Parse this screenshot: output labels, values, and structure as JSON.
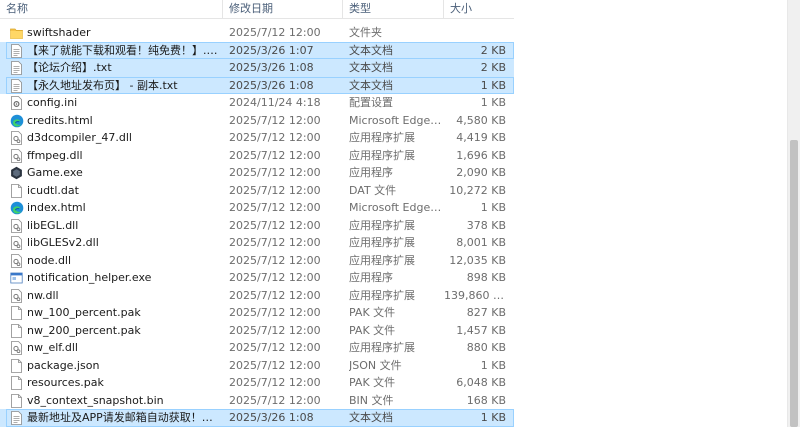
{
  "columns": {
    "name": "名称",
    "date": "修改日期",
    "type": "类型",
    "size": "大小"
  },
  "files": [
    {
      "name": "swiftshader",
      "date": "2025/7/12 12:00",
      "type": "文件夹",
      "size": "",
      "icon": "folder-icon",
      "selected": false
    },
    {
      "name": "【来了就能下载和观看！纯免费！】.txt",
      "date": "2025/3/26 1:07",
      "type": "文本文档",
      "size": "2 KB",
      "icon": "text-file-icon",
      "selected": true
    },
    {
      "name": "【论坛介绍】.txt",
      "date": "2025/3/26 1:08",
      "type": "文本文档",
      "size": "2 KB",
      "icon": "text-file-icon",
      "selected": true
    },
    {
      "name": "【永久地址发布页】 - 副本.txt",
      "date": "2025/3/26 1:08",
      "type": "文本文档",
      "size": "1 KB",
      "icon": "text-file-icon",
      "selected": true
    },
    {
      "name": "config.ini",
      "date": "2024/11/24 4:18",
      "type": "配置设置",
      "size": "1 KB",
      "icon": "settings-file-icon",
      "selected": false
    },
    {
      "name": "credits.html",
      "date": "2025/7/12 12:00",
      "type": "Microsoft Edge ...",
      "size": "4,580 KB",
      "icon": "edge-icon",
      "selected": false
    },
    {
      "name": "d3dcompiler_47.dll",
      "date": "2025/7/12 12:00",
      "type": "应用程序扩展",
      "size": "4,419 KB",
      "icon": "dll-icon",
      "selected": false
    },
    {
      "name": "ffmpeg.dll",
      "date": "2025/7/12 12:00",
      "type": "应用程序扩展",
      "size": "1,696 KB",
      "icon": "dll-icon",
      "selected": false
    },
    {
      "name": "Game.exe",
      "date": "2025/7/12 12:00",
      "type": "应用程序",
      "size": "2,090 KB",
      "icon": "game-exe-icon",
      "selected": false
    },
    {
      "name": "icudtl.dat",
      "date": "2025/7/12 12:00",
      "type": "DAT 文件",
      "size": "10,272 KB",
      "icon": "blank-file-icon",
      "selected": false
    },
    {
      "name": "index.html",
      "date": "2025/7/12 12:00",
      "type": "Microsoft Edge ...",
      "size": "1 KB",
      "icon": "edge-icon",
      "selected": false
    },
    {
      "name": "libEGL.dll",
      "date": "2025/7/12 12:00",
      "type": "应用程序扩展",
      "size": "378 KB",
      "icon": "dll-icon",
      "selected": false
    },
    {
      "name": "libGLESv2.dll",
      "date": "2025/7/12 12:00",
      "type": "应用程序扩展",
      "size": "8,001 KB",
      "icon": "dll-icon",
      "selected": false
    },
    {
      "name": "node.dll",
      "date": "2025/7/12 12:00",
      "type": "应用程序扩展",
      "size": "12,035 KB",
      "icon": "dll-icon",
      "selected": false
    },
    {
      "name": "notification_helper.exe",
      "date": "2025/7/12 12:00",
      "type": "应用程序",
      "size": "898 KB",
      "icon": "exe-icon",
      "selected": false
    },
    {
      "name": "nw.dll",
      "date": "2025/7/12 12:00",
      "type": "应用程序扩展",
      "size": "139,860 KB",
      "icon": "dll-icon",
      "selected": false
    },
    {
      "name": "nw_100_percent.pak",
      "date": "2025/7/12 12:00",
      "type": "PAK 文件",
      "size": "827 KB",
      "icon": "blank-file-icon",
      "selected": false
    },
    {
      "name": "nw_200_percent.pak",
      "date": "2025/7/12 12:00",
      "type": "PAK 文件",
      "size": "1,457 KB",
      "icon": "blank-file-icon",
      "selected": false
    },
    {
      "name": "nw_elf.dll",
      "date": "2025/7/12 12:00",
      "type": "应用程序扩展",
      "size": "880 KB",
      "icon": "dll-icon",
      "selected": false
    },
    {
      "name": "package.json",
      "date": "2025/7/12 12:00",
      "type": "JSON 文件",
      "size": "1 KB",
      "icon": "blank-file-icon",
      "selected": false
    },
    {
      "name": "resources.pak",
      "date": "2025/7/12 12:00",
      "type": "PAK 文件",
      "size": "6,048 KB",
      "icon": "blank-file-icon",
      "selected": false
    },
    {
      "name": "v8_context_snapshot.bin",
      "date": "2025/7/12 12:00",
      "type": "BIN 文件",
      "size": "168 KB",
      "icon": "blank-file-icon",
      "selected": false
    },
    {
      "name": "最新地址及APP请发邮箱自动获取！！！....",
      "date": "2025/3/26 1:08",
      "type": "文本文档",
      "size": "1 KB",
      "icon": "text-file-icon",
      "selected": true
    }
  ]
}
